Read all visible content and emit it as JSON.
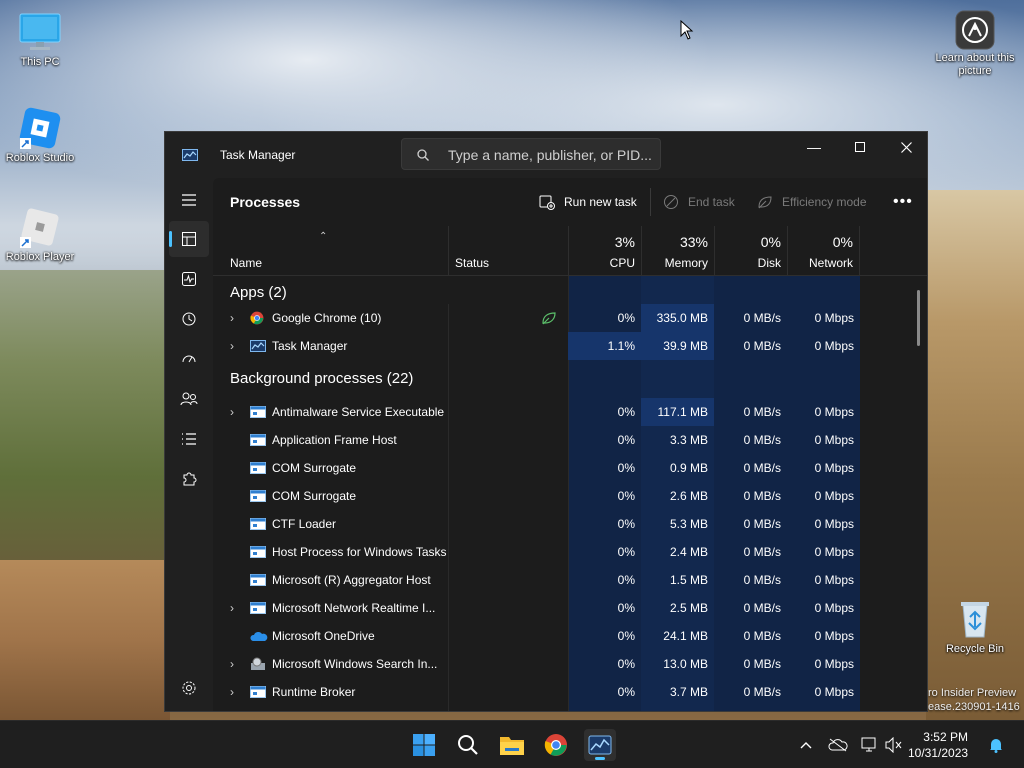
{
  "desktop": {
    "icons": [
      {
        "label": "This PC",
        "icon": "monitor-icon"
      },
      {
        "label": "Roblox Studio",
        "icon": "roblox-studio-icon"
      },
      {
        "label": "Roblox Player",
        "icon": "roblox-player-icon"
      }
    ],
    "learn_about": "Learn about this picture",
    "recycle_bin": "Recycle Bin",
    "watermark_line1": "ro Insider Preview",
    "watermark_line2": "ease.230901-1416"
  },
  "window": {
    "title": "Task Manager",
    "search_placeholder": "Type a name, publisher, or PID..."
  },
  "toolbar": {
    "page_title": "Processes",
    "run_new_task": "Run new task",
    "end_task": "End task",
    "efficiency_mode": "Efficiency mode"
  },
  "columns": {
    "name": "Name",
    "status": "Status",
    "cpu_pct": "3%",
    "cpu": "CPU",
    "memory_pct": "33%",
    "memory": "Memory",
    "disk_pct": "0%",
    "disk": "Disk",
    "network_pct": "0%",
    "network": "Network"
  },
  "groups": {
    "apps": "Apps (2)",
    "background": "Background processes (22)"
  },
  "apps": [
    {
      "name": "Google Chrome (10)",
      "cpu": "0%",
      "memory": "335.0 MB",
      "disk": "0 MB/s",
      "network": "0 Mbps",
      "expandable": true,
      "icon": "chrome-icon",
      "efficiency": true
    },
    {
      "name": "Task Manager",
      "cpu": "1.1%",
      "memory": "39.9 MB",
      "disk": "0 MB/s",
      "network": "0 Mbps",
      "expandable": true,
      "icon": "task-manager-icon"
    }
  ],
  "background": [
    {
      "name": "Antimalware Service Executable",
      "cpu": "0%",
      "memory": "117.1 MB",
      "disk": "0 MB/s",
      "network": "0 Mbps",
      "expandable": true
    },
    {
      "name": "Application Frame Host",
      "cpu": "0%",
      "memory": "3.3 MB",
      "disk": "0 MB/s",
      "network": "0 Mbps",
      "expandable": false
    },
    {
      "name": "COM Surrogate",
      "cpu": "0%",
      "memory": "0.9 MB",
      "disk": "0 MB/s",
      "network": "0 Mbps",
      "expandable": false
    },
    {
      "name": "COM Surrogate",
      "cpu": "0%",
      "memory": "2.6 MB",
      "disk": "0 MB/s",
      "network": "0 Mbps",
      "expandable": false
    },
    {
      "name": "CTF Loader",
      "cpu": "0%",
      "memory": "5.3 MB",
      "disk": "0 MB/s",
      "network": "0 Mbps",
      "expandable": false
    },
    {
      "name": "Host Process for Windows Tasks",
      "cpu": "0%",
      "memory": "2.4 MB",
      "disk": "0 MB/s",
      "network": "0 Mbps",
      "expandable": false
    },
    {
      "name": "Microsoft (R) Aggregator Host",
      "cpu": "0%",
      "memory": "1.5 MB",
      "disk": "0 MB/s",
      "network": "0 Mbps",
      "expandable": false
    },
    {
      "name": "Microsoft Network Realtime I...",
      "cpu": "0%",
      "memory": "2.5 MB",
      "disk": "0 MB/s",
      "network": "0 Mbps",
      "expandable": true
    },
    {
      "name": "Microsoft OneDrive",
      "cpu": "0%",
      "memory": "24.1 MB",
      "disk": "0 MB/s",
      "network": "0 Mbps",
      "expandable": false,
      "icon": "onedrive-icon"
    },
    {
      "name": "Microsoft Windows Search In...",
      "cpu": "0%",
      "memory": "13.0 MB",
      "disk": "0 MB/s",
      "network": "0 Mbps",
      "expandable": true,
      "icon": "search-indexer-icon"
    },
    {
      "name": "Runtime Broker",
      "cpu": "0%",
      "memory": "3.7 MB",
      "disk": "0 MB/s",
      "network": "0 Mbps",
      "expandable": true
    }
  ],
  "taskbar": {
    "time": "3:52 PM",
    "date": "10/31/2023"
  },
  "colors": {
    "accent": "#4cc2ff",
    "heat_low": "#112446",
    "heat_mid": "#16356b",
    "heat_high": "#1c4a96"
  }
}
